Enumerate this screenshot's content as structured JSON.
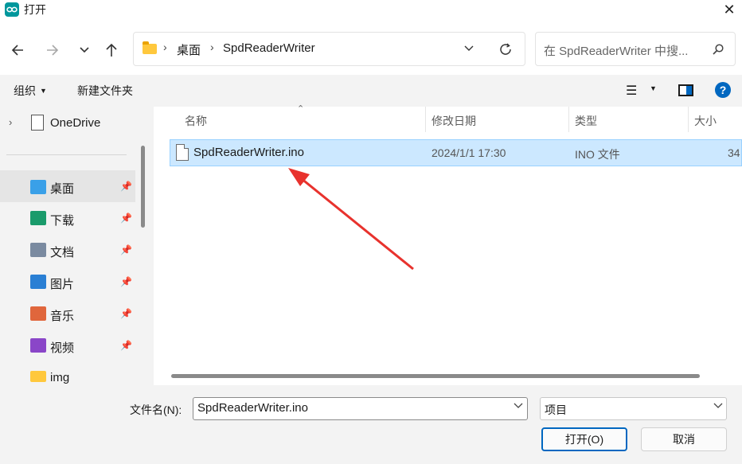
{
  "window": {
    "title": "打开",
    "close_glyph": "✕"
  },
  "nav": {
    "breadcrumb": [
      "桌面",
      "SpdReaderWriter"
    ],
    "search_placeholder": "在 SpdReaderWriter 中搜..."
  },
  "toolbar": {
    "organize": "组织",
    "new_folder": "新建文件夹"
  },
  "sidebar": {
    "onedrive": "OneDrive",
    "items": [
      {
        "label": "桌面",
        "icon": "desktop-icon",
        "color": "#3aa0e8",
        "active": true
      },
      {
        "label": "下载",
        "icon": "download-icon",
        "color": "#1a9b6b"
      },
      {
        "label": "文档",
        "icon": "documents-icon",
        "color": "#7a8aa0"
      },
      {
        "label": "图片",
        "icon": "pictures-icon",
        "color": "#2a7fd4"
      },
      {
        "label": "音乐",
        "icon": "music-icon",
        "color": "#e0663c"
      },
      {
        "label": "视频",
        "icon": "videos-icon",
        "color": "#8a46c8"
      },
      {
        "label": "img",
        "icon": "folder-icon",
        "color": "#ffc83d"
      }
    ]
  },
  "columns": {
    "name": "名称",
    "modified": "修改日期",
    "type": "类型",
    "size": "大小"
  },
  "files": [
    {
      "name": "SpdReaderWriter.ino",
      "modified": "2024/1/1 17:30",
      "type": "INO 文件",
      "size": "34"
    }
  ],
  "bottom": {
    "filename_label": "文件名(N):",
    "filename_value": "SpdReaderWriter.ino",
    "filetype": "项目",
    "open": "打开(O)",
    "cancel": "取消"
  },
  "colors": {
    "accent": "#0067c0",
    "selection": "#cce8ff",
    "arrow": "#e8322d"
  }
}
